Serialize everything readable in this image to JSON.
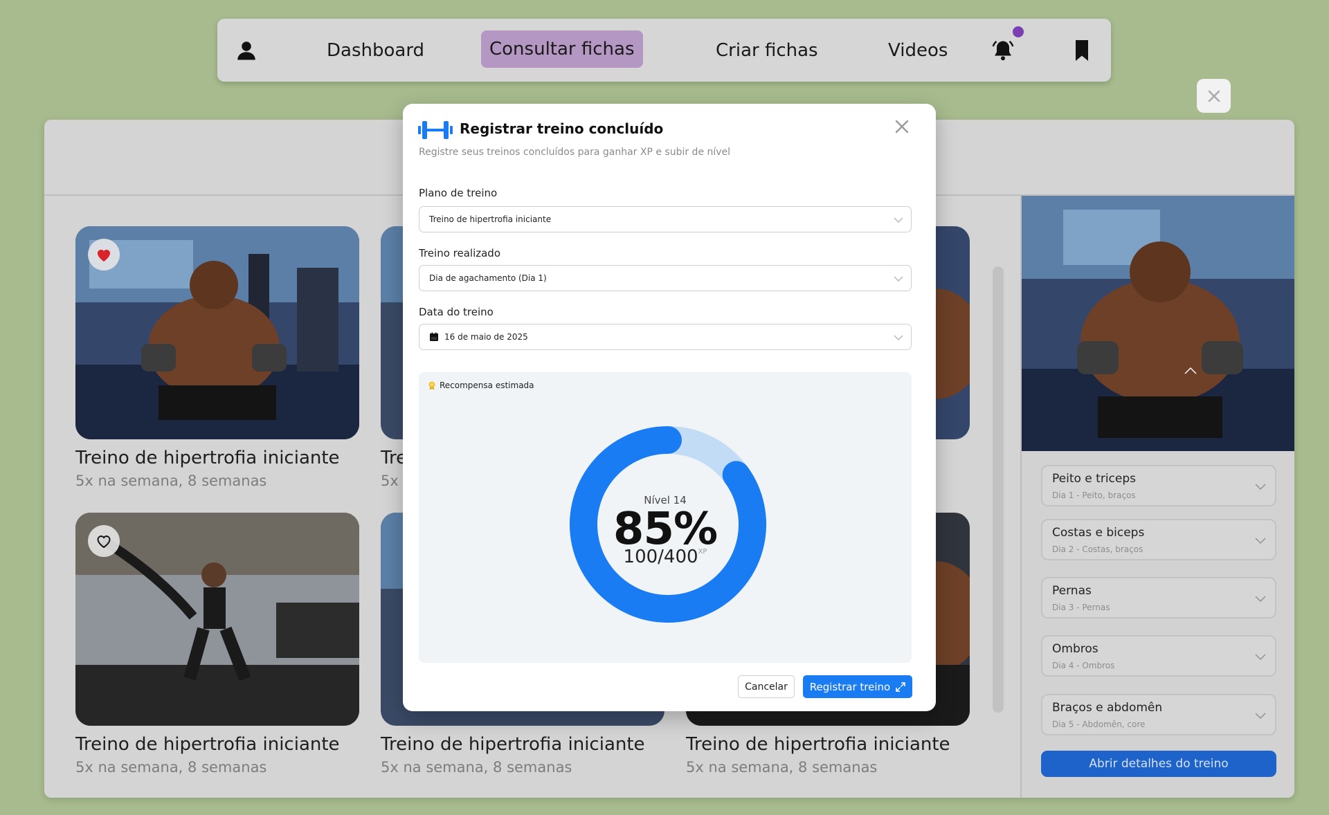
{
  "nav": {
    "dashboard": "Dashboard",
    "consultar": "Consultar fichas",
    "criar": "Criar fichas",
    "videos": "Videos"
  },
  "cards": [
    {
      "title": "Treino de hipertrofia iniciante",
      "sub": "5x na semana, 8 semanas"
    },
    {
      "title": "Tre",
      "sub": "5x n"
    },
    {
      "title": "Treino de hipertrofia iniciante",
      "sub": "5x na semana, 8 semanas"
    },
    {
      "title": "Treino de hipertrofia iniciante",
      "sub": "5x na semana, 8 semanas"
    },
    {
      "title": "Treino de hipertrofia iniciante",
      "sub": "5x na semana, 8 semanas"
    }
  ],
  "side": {
    "days": [
      {
        "title": "Peito e triceps",
        "sub": "Dia 1 - Peito, braços"
      },
      {
        "title": "Costas e biceps",
        "sub": "Dia 2 - Costas, braços"
      },
      {
        "title": "Pernas",
        "sub": "Dia 3 - Pernas"
      },
      {
        "title": "Ombros",
        "sub": "Dia 4 - Ombros"
      },
      {
        "title": "Braços e abdomên",
        "sub": "Dia 5 - Abdomên, core"
      }
    ],
    "open_button": "Abrir detalhes do treino"
  },
  "modal": {
    "title": "Registrar treino concluído",
    "subtitle": "Registre seus treinos concluídos para ganhar XP e subir de nível",
    "plan_label": "Plano de treino",
    "plan_value": "Treino de hipertrofia iniciante",
    "workout_label": "Treino realizado",
    "workout_value": "Dia de agachamento (Dia 1)",
    "date_label": "Data do treino",
    "date_value": "16 de maio de 2025",
    "reward_label": "Recompensa estimada",
    "level": "Nível 14",
    "percent": "85%",
    "xp": "100/400",
    "xp_unit": "XP",
    "progress_fraction": 0.85,
    "gain_fraction": 0.2,
    "cancel": "Cancelar",
    "register": "Registrar treino"
  },
  "colors": {
    "accent": "#1a7cf2",
    "gain": "#c3dcf6",
    "track": "#eeeeee",
    "nav_active": "#b497c2",
    "heart": "#d8232a"
  }
}
